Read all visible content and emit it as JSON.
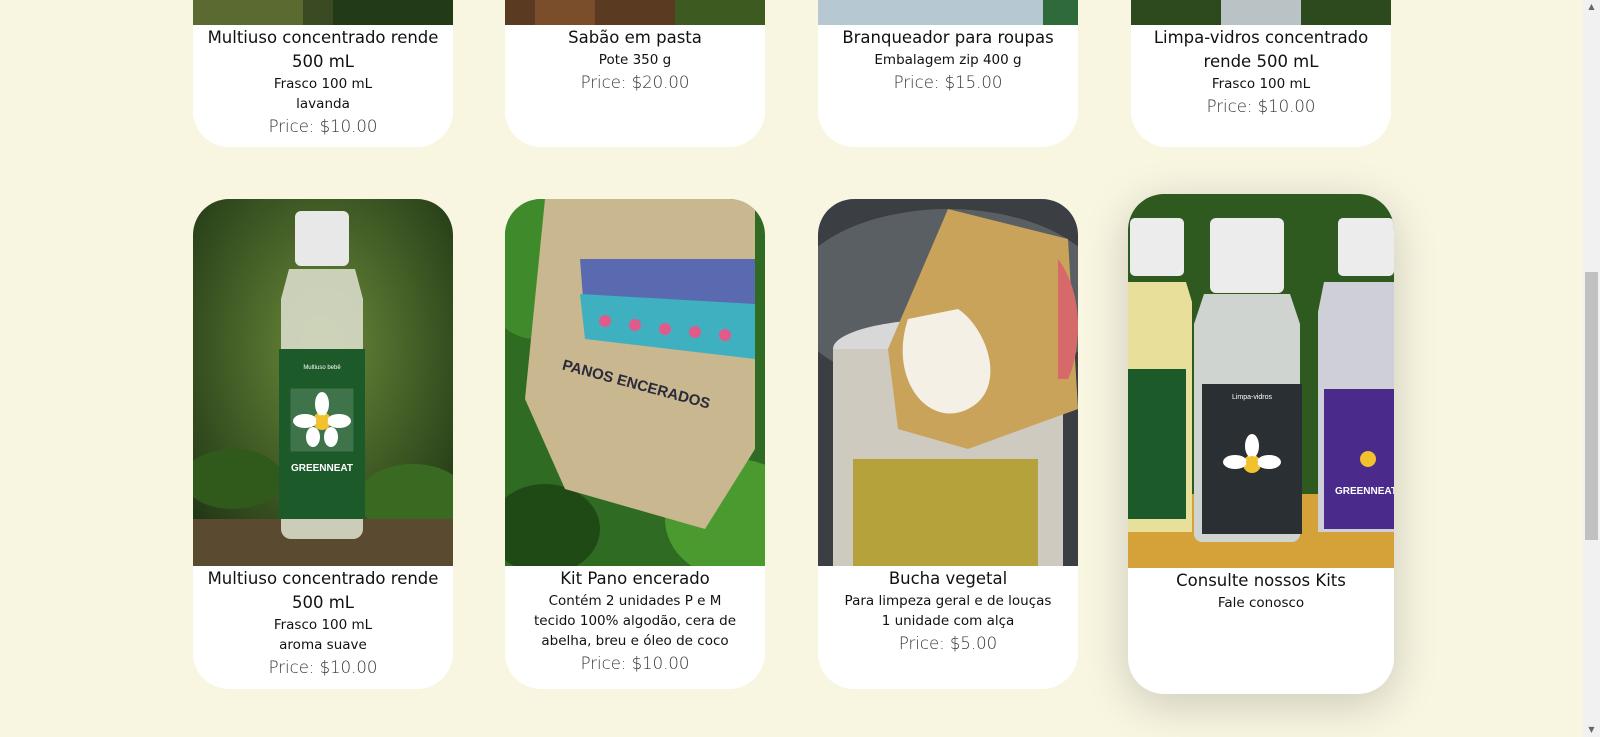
{
  "row1": [
    {
      "title": "Multiuso concentrado rende 500 mL",
      "sub1": "Frasco 100 mL",
      "sub2": "lavanda",
      "price": "Price: $10.00"
    },
    {
      "title": "Sabão em pasta",
      "sub1": "Pote 350 g",
      "price": "Price: $20.00"
    },
    {
      "title": "Branqueador para roupas",
      "sub1": "Embalagem zip 400 g",
      "price": "Price: $15.00"
    },
    {
      "title": "Limpa-vidros concentrado rende 500 mL",
      "sub1": "Frasco 100 mL",
      "price": "Price: $10.00"
    }
  ],
  "row2": [
    {
      "title": "Multiuso concentrado rende 500 mL",
      "sub1": "Frasco 100 mL",
      "sub2": "aroma suave",
      "price": "Price: $10.00",
      "photo_text": "Multiuso bebê",
      "photo_brand": "GREENNEAT"
    },
    {
      "title": "Kit Pano encerado",
      "sub1": "Contém 2 unidades P e M",
      "sub2": "tecido 100% algodão, cera de abelha, breu e óleo de coco",
      "price": "Price: $10.00",
      "photo_text": "PANOS ENCERADOS"
    },
    {
      "title": "Bucha vegetal",
      "sub1": "Para limpeza geral e de louças",
      "sub2": "1 unidade com alça",
      "price": "Price: $5.00"
    },
    {
      "title": "Consulte nossos Kits",
      "sub1": "Fale conosco",
      "photo_brand": "GREENNEAT",
      "photo_text": "Limpa-vidros"
    }
  ],
  "colors": {
    "background": "#f8f6e1",
    "card": "#ffffff",
    "leaf_green": "#2d6b2a"
  }
}
